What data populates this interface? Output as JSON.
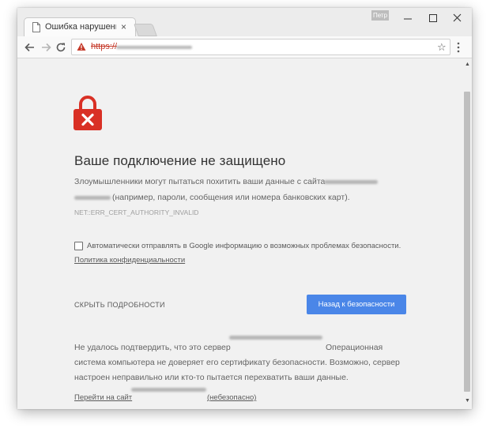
{
  "browser": {
    "tab_title": "Ошибка нарушения ко",
    "tab_close": "×",
    "user_badge": "Петр",
    "window_controls": {
      "minimize": "minimize-icon",
      "maximize": "maximize-icon",
      "close": "close-icon"
    },
    "address_bar": {
      "scheme": "https://",
      "security_state": "not-secure-warning-icon",
      "bookmark_glyph": "☆"
    }
  },
  "error_page": {
    "heading": "Ваше подключение не защищено",
    "description_part1": "Злоумышленники могут пытаться похитить ваши данные с сайта",
    "description_part2": "(например, пароли, сообщения или номера банковских карт).",
    "error_code": "NET::ERR_CERT_AUTHORITY_INVALID",
    "checkbox_label": "Автоматически отправлять в Google информацию о возможных проблемах безопасности.",
    "checkbox_checked": false,
    "privacy_link": "Политика конфиденциальности",
    "details_button": "СКРЫТЬ ПОДРОБНОСТИ",
    "back_button": "Назад к безопасности",
    "details_line1_start": "Не удалось подтвердить, что это сервер",
    "details_line1_end": "Операционная",
    "details_line2": "система компьютера не доверяет его сертификату безопасности. Возможно, сервер",
    "details_line3": "настроен неправильно или кто-то пытается перехватить ваши данные.",
    "proceed_link_start": "Перейти на сайт",
    "proceed_link_end": "(небезопасно)"
  },
  "colors": {
    "accent": "#4a86e8",
    "danger": "#d93025",
    "page_bg": "#f1f1f1",
    "warning": "#c53929"
  }
}
